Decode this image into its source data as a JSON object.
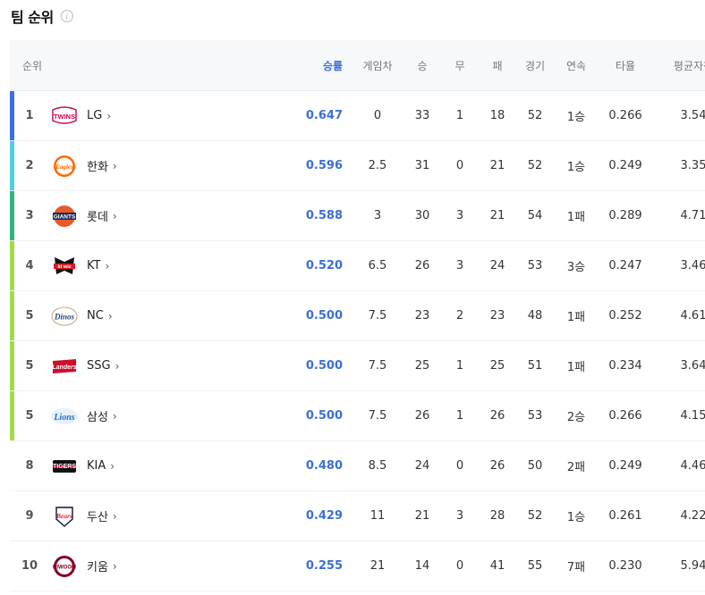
{
  "header": {
    "title": "팀 순위",
    "info_icon": "info-icon"
  },
  "columns": {
    "rank": "순위",
    "pct": "승률",
    "gb": "게임차",
    "w": "승",
    "d": "무",
    "l": "패",
    "g": "경기",
    "streak": "연속",
    "avg": "타율",
    "era": "평균자책"
  },
  "colors": {
    "accent_blue": "#3a6fd8",
    "bar_rank1": "#3b6fe0",
    "bar_rank2": "#4fd0e0",
    "bar_rank3": "#2fb57a",
    "bar_rank4_7": "#a6d94a"
  },
  "rows": [
    {
      "rank": "1",
      "team": "LG",
      "logo": "twins-logo",
      "pct": "0.647",
      "gb": "0",
      "w": "33",
      "d": "1",
      "l": "18",
      "g": "52",
      "streak": "1승",
      "avg": "0.266",
      "era": "3.54",
      "bar": "#3b6fe0"
    },
    {
      "rank": "2",
      "team": "한화",
      "logo": "eagles-logo",
      "pct": "0.596",
      "gb": "2.5",
      "w": "31",
      "d": "0",
      "l": "21",
      "g": "52",
      "streak": "1승",
      "avg": "0.249",
      "era": "3.35",
      "bar": "#4fd0e0"
    },
    {
      "rank": "3",
      "team": "롯데",
      "logo": "giants-logo",
      "pct": "0.588",
      "gb": "3",
      "w": "30",
      "d": "3",
      "l": "21",
      "g": "54",
      "streak": "1패",
      "avg": "0.289",
      "era": "4.71",
      "bar": "#2fb57a"
    },
    {
      "rank": "4",
      "team": "KT",
      "logo": "ktwiz-logo",
      "pct": "0.520",
      "gb": "6.5",
      "w": "26",
      "d": "3",
      "l": "24",
      "g": "53",
      "streak": "3승",
      "avg": "0.247",
      "era": "3.46",
      "bar": "#a6d94a"
    },
    {
      "rank": "5",
      "team": "NC",
      "logo": "dinos-logo",
      "pct": "0.500",
      "gb": "7.5",
      "w": "23",
      "d": "2",
      "l": "23",
      "g": "48",
      "streak": "1패",
      "avg": "0.252",
      "era": "4.61",
      "bar": "#a6d94a"
    },
    {
      "rank": "5",
      "team": "SSG",
      "logo": "landers-logo",
      "pct": "0.500",
      "gb": "7.5",
      "w": "25",
      "d": "1",
      "l": "25",
      "g": "51",
      "streak": "1패",
      "avg": "0.234",
      "era": "3.64",
      "bar": "#a6d94a"
    },
    {
      "rank": "5",
      "team": "삼성",
      "logo": "lions-logo",
      "pct": "0.500",
      "gb": "7.5",
      "w": "26",
      "d": "1",
      "l": "26",
      "g": "53",
      "streak": "2승",
      "avg": "0.266",
      "era": "4.15",
      "bar": "#a6d94a"
    },
    {
      "rank": "8",
      "team": "KIA",
      "logo": "tigers-logo",
      "pct": "0.480",
      "gb": "8.5",
      "w": "24",
      "d": "0",
      "l": "26",
      "g": "50",
      "streak": "2패",
      "avg": "0.249",
      "era": "4.46",
      "bar": ""
    },
    {
      "rank": "9",
      "team": "두산",
      "logo": "bears-logo",
      "pct": "0.429",
      "gb": "11",
      "w": "21",
      "d": "3",
      "l": "28",
      "g": "52",
      "streak": "1승",
      "avg": "0.261",
      "era": "4.22",
      "bar": ""
    },
    {
      "rank": "10",
      "team": "키움",
      "logo": "heroes-logo",
      "pct": "0.255",
      "gb": "21",
      "w": "14",
      "d": "0",
      "l": "41",
      "g": "55",
      "streak": "7패",
      "avg": "0.230",
      "era": "5.94",
      "bar": ""
    }
  ]
}
